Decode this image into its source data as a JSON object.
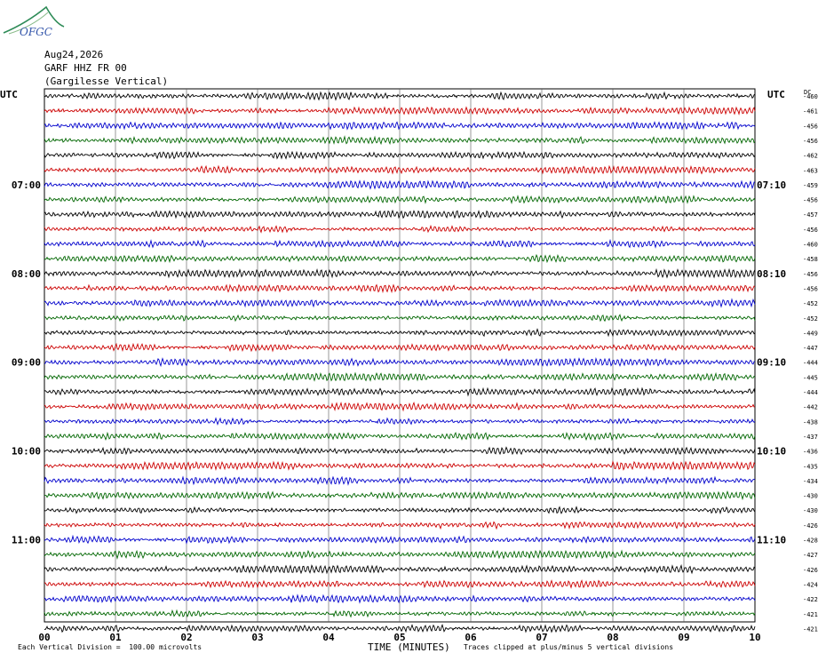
{
  "header": {
    "logo_text": "OFGC",
    "date": "Aug24,2026",
    "station": "GARF HHZ FR 00",
    "location": "(Gargilesse Vertical)"
  },
  "footer": {
    "scale_note": "Each Vertical Division =  100.00 microvolts",
    "clip_note": "Traces clipped at plus/minus 5 vertical divisions"
  },
  "chart_data": {
    "type": "line",
    "title": "",
    "xlabel": "TIME (MINUTES)",
    "ylabel": "",
    "left_axis_label": "UTC",
    "right_axis_label": "UTC",
    "dc_label": "DC",
    "x_ticks": [
      "00",
      "01",
      "02",
      "03",
      "04",
      "05",
      "06",
      "07",
      "08",
      "09",
      "10"
    ],
    "xlim": [
      0,
      10
    ],
    "left_hour_labels": [
      {
        "row": 6,
        "label": "07:00"
      },
      {
        "row": 12,
        "label": "08:00"
      },
      {
        "row": 18,
        "label": "09:00"
      },
      {
        "row": 24,
        "label": "10:00"
      },
      {
        "row": 30,
        "label": "11:00"
      }
    ],
    "right_time_labels": [
      {
        "row": 6,
        "label": "07:10"
      },
      {
        "row": 12,
        "label": "08:10"
      },
      {
        "row": 18,
        "label": "09:10"
      },
      {
        "row": 24,
        "label": "10:10"
      },
      {
        "row": 30,
        "label": "11:10"
      }
    ],
    "trace_colors": [
      "#000000",
      "#cc0000",
      "#0000cc",
      "#006600"
    ],
    "dc_offsets": [
      -460,
      -461,
      -456,
      -456,
      -462,
      -463,
      -459,
      -456,
      -457,
      -456,
      -460,
      -458,
      -456,
      -456,
      -452,
      -452,
      -449,
      -447,
      -444,
      -445,
      -444,
      -442,
      -438,
      -437,
      -436,
      -435,
      -434,
      -430,
      -430,
      -426,
      -428,
      -427,
      -426,
      -424,
      -422,
      -421,
      -421
    ],
    "grid": true
  }
}
